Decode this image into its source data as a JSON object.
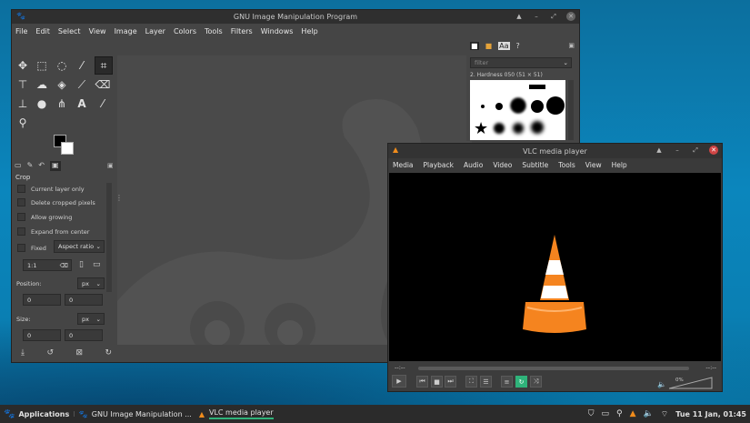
{
  "gimp": {
    "title": "GNU Image Manipulation Program",
    "menu": [
      "File",
      "Edit",
      "Select",
      "View",
      "Image",
      "Layer",
      "Colors",
      "Tools",
      "Filters",
      "Windows",
      "Help"
    ],
    "brushes_filter_placeholder": "filter",
    "brush_name": "2. Hardness 050 (51 × 51)",
    "tool_options": {
      "title": "Crop",
      "current_layer_only": "Current layer only",
      "delete_cropped": "Delete cropped pixels",
      "allow_growing": "Allow growing",
      "expand_center": "Expand from center",
      "fixed": "Fixed",
      "aspect": "Aspect ratio",
      "ratio_value": "1:1",
      "position_label": "Position:",
      "size_label": "Size:",
      "unit": "px",
      "pos_x": "0",
      "pos_y": "0",
      "size_x": "0",
      "size_y": "0"
    }
  },
  "vlc": {
    "title": "VLC media player",
    "menu": [
      "Media",
      "Playback",
      "Audio",
      "Video",
      "Subtitle",
      "Tools",
      "View",
      "Help"
    ],
    "time_left": "--:--",
    "time_right": "--:--",
    "volume": "0%"
  },
  "taskbar": {
    "applications": "Applications",
    "gimp_task": "GNU Image Manipulation ...",
    "vlc_task": "VLC media player",
    "clock": "Tue 11 Jan, 01:45"
  },
  "colors": {
    "accent_green": "#2fb37a",
    "vlc_orange": "#f08c1c",
    "desktop": "#0b86bd"
  }
}
